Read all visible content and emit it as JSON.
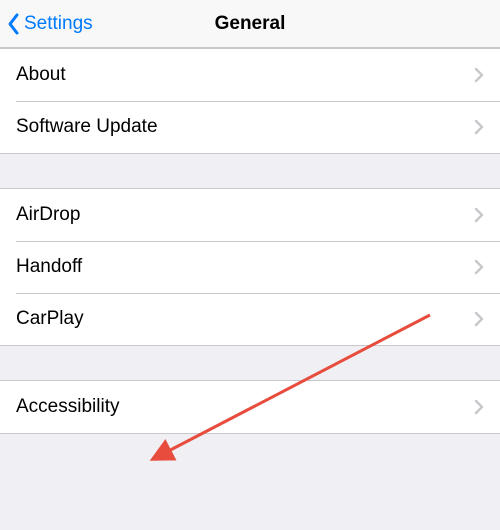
{
  "nav": {
    "back_label": "Settings",
    "title": "General"
  },
  "groups": [
    {
      "items": [
        {
          "label": "About"
        },
        {
          "label": "Software Update"
        }
      ]
    },
    {
      "items": [
        {
          "label": "AirDrop"
        },
        {
          "label": "Handoff"
        },
        {
          "label": "CarPlay"
        }
      ]
    },
    {
      "items": [
        {
          "label": "Accessibility"
        }
      ]
    }
  ],
  "annotation": {
    "color": "#e74c3c"
  }
}
